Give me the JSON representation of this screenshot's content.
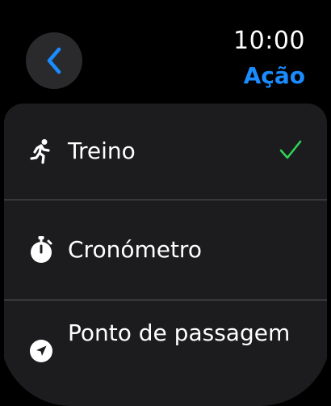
{
  "status": {
    "time": "10:00"
  },
  "header": {
    "title": "Ação"
  },
  "menu": {
    "items": [
      {
        "label": "Treino",
        "icon": "running-figure-icon",
        "selected": true
      },
      {
        "label": "Cronómetro",
        "icon": "stopwatch-icon",
        "selected": false
      },
      {
        "label": "Ponto de passagem",
        "icon": "location-arrow-icon",
        "selected": false
      }
    ]
  },
  "colors": {
    "accent": "#1a8cff",
    "check": "#30d158",
    "background": "#000000",
    "list_background": "#1c1c1e"
  }
}
